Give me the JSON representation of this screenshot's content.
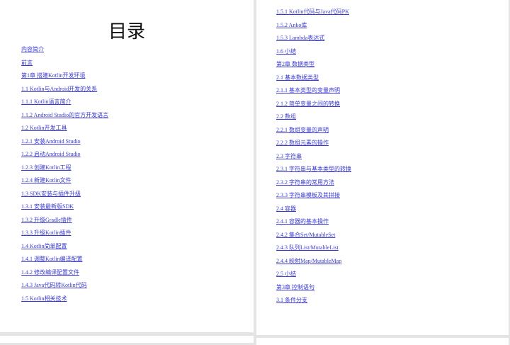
{
  "left_page": {
    "title": "目录",
    "entries": [
      "内容简介",
      "前言",
      "第1章 搭建Kotlin开发环境",
      "1.1 Kotlin与Android开发的关系",
      "1.1.1 Kotlin语言简介",
      "1.1.2 Android Studio的官方开发语言",
      "1.2 Kotlin开发工具",
      "1.2.1 安装Android Studio",
      "1.2.2 启动Android Studio",
      "1.2.3 创建Kotlin工程",
      "1.2.4 新建Kotlin文件",
      "1.3 SDK安装与插件升级",
      "1.3.1 安装最新版SDK",
      "1.3.2 升级Gradle插件",
      "1.3.3 升级Kotlin插件",
      "1.4 Kotlin简单配置",
      "1.4.1 调整Kotlin编译配置",
      "1.4.2 修改编译配置文件",
      "1.4.3 Java代码转Kotlin代码",
      "1.5 Kotlin相关技术"
    ]
  },
  "right_page": {
    "entries": [
      "1.5.1 Kotlin代码与Java代码PK",
      "1.5.2 Anko库",
      "1.5.3 Lambda表达式",
      "1.6 小结",
      "第2章 数据类型",
      "2.1 基本数据类型",
      "2.1.1 基本类型的变量声明",
      "2.1.2 简单变量之间的转换",
      "2.2 数组",
      "2.2.1 数组变量的声明",
      "2.2.2 数组元素的操作",
      "2.3 字符串",
      "2.3.1 字符串与基本类型的转换",
      "2.3.2 字符串的常用方法",
      "2.3.3 字符串模板及其拼接",
      "2.4 容器",
      "2.4.1 容器的基本操作",
      "2.4.2 集合Set/MutableSet",
      "2.4.3 队列List/MutableList",
      "2.4.4 映射Map/MutableMap",
      "2.5 小结",
      "第3章 控制语句",
      "3.1 条件分支"
    ]
  }
}
